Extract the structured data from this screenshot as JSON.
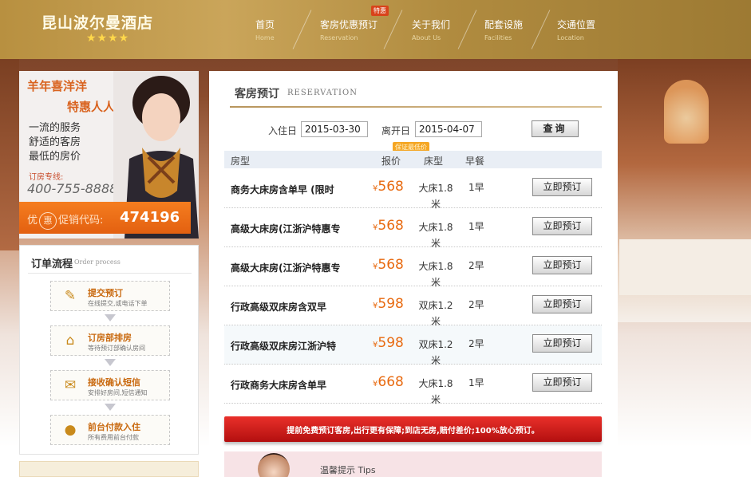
{
  "header": {
    "logo": "昆山波尔曼酒店",
    "stars": "★★★★",
    "badge": "特惠",
    "nav": [
      {
        "cn": "首页",
        "en": "Home"
      },
      {
        "cn": "客房优惠预订",
        "en": "Reservation"
      },
      {
        "cn": "关于我们",
        "en": "About Us"
      },
      {
        "cn": "配套设施",
        "en": "Facilities"
      },
      {
        "cn": "交通位置",
        "en": "Location"
      }
    ]
  },
  "promo": {
    "headline1": "羊年喜洋洋",
    "headline2": "特惠人人享",
    "lines": [
      "一流的服务",
      "舒适的客房",
      "最低的房价"
    ],
    "tel_label": "订房专线:",
    "tel": "400-755-8888",
    "code_label_pre": "优",
    "code_circle": "惠",
    "code_label_post": "促销代码:",
    "code": "474196"
  },
  "process": {
    "title": "订单流程",
    "title_en": "Order process",
    "steps": [
      {
        "title": "提交预订",
        "desc": "在线提交,或电话下单",
        "icon": "pencil-icon"
      },
      {
        "title": "订房部排房",
        "desc": "等待预订部确认房间",
        "icon": "house-icon"
      },
      {
        "title": "接收确认短信",
        "desc": "安排好房间,短信通知",
        "icon": "chat-icon"
      },
      {
        "title": "前台付款入住",
        "desc": "所有费用前台付款",
        "icon": "person-icon"
      }
    ]
  },
  "reservation": {
    "title": "客房预订",
    "title_en": "RESERVATION",
    "checkin_label": "入住日",
    "checkin_value": "2015-03-30",
    "checkout_label": "离开日",
    "checkout_value": "2015-04-07",
    "query_label": "查询",
    "price_badge": "保证最低价",
    "columns": {
      "type": "房型",
      "price": "报价",
      "bed": "床型",
      "breakfast": "早餐"
    },
    "rows": [
      {
        "name": "商务大床房含单早 (限时",
        "currency": "¥",
        "price": "568",
        "bed": "大床1.8米",
        "breakfast": "1早",
        "book": "立即预订"
      },
      {
        "name": "高级大床房(江浙沪特惠专",
        "currency": "¥",
        "price": "568",
        "bed": "大床1.8米",
        "breakfast": "1早",
        "book": "立即预订"
      },
      {
        "name": "高级大床房(江浙沪特惠专",
        "currency": "¥",
        "price": "568",
        "bed": "大床1.8米",
        "breakfast": "2早",
        "book": "立即预订"
      },
      {
        "name": "行政高级双床房含双早",
        "currency": "¥",
        "price": "598",
        "bed": "双床1.2米",
        "breakfast": "2早",
        "book": "立即预订"
      },
      {
        "name": "行政高级双床房江浙沪特",
        "currency": "¥",
        "price": "598",
        "bed": "双床1.2米",
        "breakfast": "2早",
        "book": "立即预订"
      },
      {
        "name": "行政商务大床房含单早",
        "currency": "¥",
        "price": "668",
        "bed": "大床1.8米",
        "breakfast": "1早",
        "book": "立即预订"
      }
    ],
    "banner": "提前免费预订客房,出行更有保障;到店无房,赔付差价;100%放心预订。",
    "tips": "温馨提示 Tips"
  }
}
